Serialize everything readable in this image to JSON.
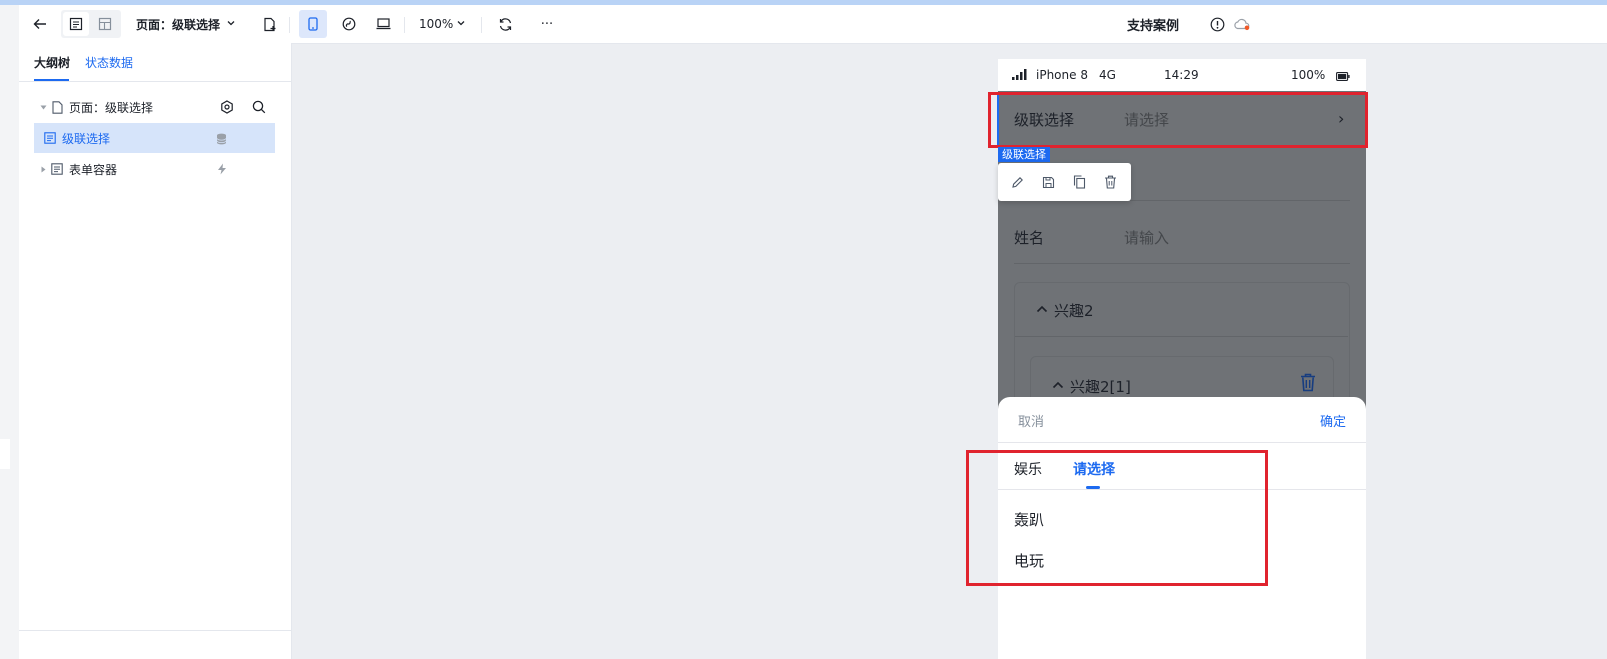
{
  "toolbar": {
    "page_selector": "页面：级联选择",
    "zoom": "100%",
    "more": "···",
    "support_label": "支持案例"
  },
  "sidebar": {
    "tabs": [
      "大纲树",
      "状态数据"
    ],
    "tree": [
      {
        "label": "页面：级联选择"
      },
      {
        "label": "级联选择",
        "selected": true
      },
      {
        "label": "表单容器"
      }
    ]
  },
  "phone": {
    "status": {
      "device": "iPhone 8",
      "network": "4G",
      "time": "14:29",
      "battery": "100%"
    },
    "cascader_label": "级联选择",
    "cascader_placeholder": "请选择",
    "cascader_chevron": "›",
    "component_tag": "级联选择",
    "name_label": "姓名",
    "name_placeholder": "请输入",
    "group_title": "兴趣2",
    "subgroup_title": "兴趣2[1]"
  },
  "sheet": {
    "cancel": "取消",
    "confirm": "确定",
    "tabs": [
      "娱乐",
      "请选择"
    ],
    "options": [
      "轰趴",
      "电玩"
    ]
  },
  "colors": {
    "accent": "#1d6af0",
    "highlight_box": "#e0232e",
    "selected_row": "#d6e4fa"
  }
}
